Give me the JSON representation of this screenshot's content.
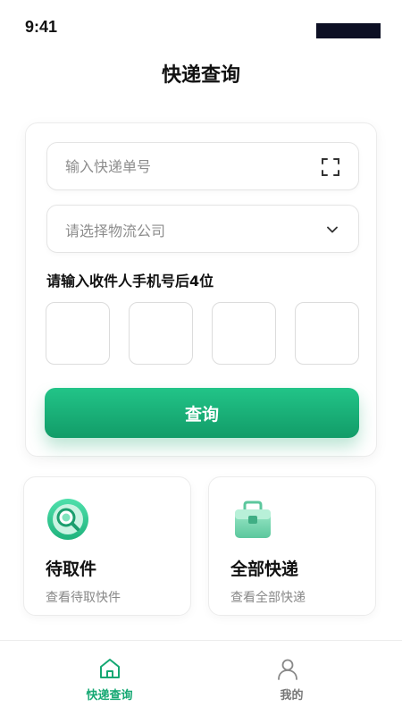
{
  "status": {
    "time": "9:41"
  },
  "header": {
    "title": "快递查询"
  },
  "query_card": {
    "tracking_placeholder": "输入快递单号",
    "company_placeholder": "请选择物流公司",
    "phone_label": "请输入收件人手机号后4位",
    "digits": [
      "",
      "",
      "",
      ""
    ],
    "query_button": "查询"
  },
  "tiles": [
    {
      "title": "待取件",
      "subtitle": "查看待取快件",
      "icon": "search-package-icon"
    },
    {
      "title": "全部快递",
      "subtitle": "查看全部快递",
      "icon": "package-box-icon"
    }
  ],
  "tab_bar": {
    "items": [
      {
        "label": "快递查询",
        "icon": "home-icon",
        "active": true
      },
      {
        "label": "我的",
        "icon": "user-icon",
        "active": false
      }
    ]
  },
  "colors": {
    "accent": "#15a873",
    "text": "#111111",
    "muted": "#8d8d8d"
  }
}
